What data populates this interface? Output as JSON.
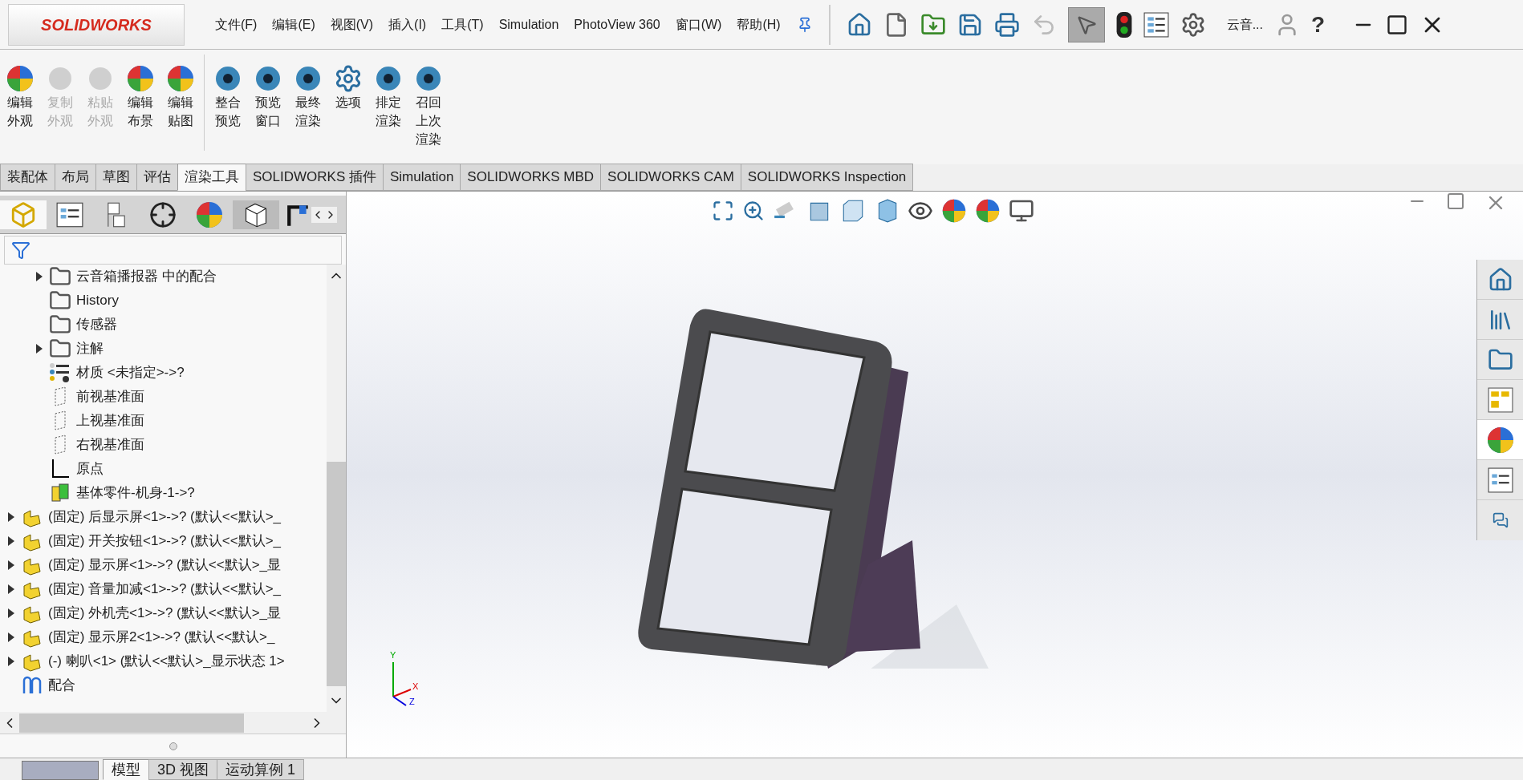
{
  "title_bar": {
    "logo": "SOLIDWORKS",
    "menu": [
      "文件(F)",
      "编辑(E)",
      "视图(V)",
      "插入(I)",
      "工具(T)",
      "Simulation",
      "PhotoView 360",
      "窗口(W)",
      "帮助(H)"
    ],
    "document": "云音...",
    "help": "?"
  },
  "ribbon": {
    "buttons": [
      {
        "lines": [
          "编辑",
          "外观"
        ],
        "disabled": false
      },
      {
        "lines": [
          "复制",
          "外观"
        ],
        "disabled": true
      },
      {
        "lines": [
          "粘贴",
          "外观"
        ],
        "disabled": true
      },
      {
        "lines": [
          "编辑",
          "布景"
        ],
        "disabled": false
      },
      {
        "lines": [
          "编辑",
          "贴图"
        ],
        "disabled": false
      },
      {
        "lines": [
          "整合",
          "预览"
        ],
        "disabled": false
      },
      {
        "lines": [
          "预览",
          "窗口"
        ],
        "disabled": false
      },
      {
        "lines": [
          "最终",
          "渲染"
        ],
        "disabled": false
      },
      {
        "lines": [
          "选项"
        ],
        "disabled": false
      },
      {
        "lines": [
          "排定",
          "渲染"
        ],
        "disabled": false
      },
      {
        "lines": [
          "召回",
          "上次",
          "渲染"
        ],
        "disabled": false
      }
    ]
  },
  "command_tabs": [
    {
      "label": "装配体",
      "selected": false
    },
    {
      "label": "布局",
      "selected": false
    },
    {
      "label": "草图",
      "selected": false
    },
    {
      "label": "评估",
      "selected": false
    },
    {
      "label": "渲染工具",
      "selected": true
    },
    {
      "label": "SOLIDWORKS 插件",
      "selected": false
    },
    {
      "label": "Simulation",
      "selected": false
    },
    {
      "label": "SOLIDWORKS MBD",
      "selected": false
    },
    {
      "label": "SOLIDWORKS CAM",
      "selected": false
    },
    {
      "label": "SOLIDWORKS Inspection",
      "selected": false
    }
  ],
  "tree": [
    {
      "kind": "mates",
      "label": "云音箱播报器 中的配合",
      "expandable": true
    },
    {
      "kind": "history",
      "label": "History",
      "expandable": false
    },
    {
      "kind": "sensors",
      "label": "传感器",
      "expandable": false
    },
    {
      "kind": "annotations",
      "label": "注解",
      "expandable": true
    },
    {
      "kind": "material",
      "label": "材质 <未指定>->?",
      "expandable": false
    },
    {
      "kind": "plane",
      "label": "前视基准面",
      "expandable": false
    },
    {
      "kind": "plane",
      "label": "上视基准面",
      "expandable": false
    },
    {
      "kind": "plane",
      "label": "右视基准面",
      "expandable": false
    },
    {
      "kind": "origin",
      "label": "原点",
      "expandable": false
    },
    {
      "kind": "base",
      "label": "基体零件-机身-1->?",
      "expandable": false
    },
    {
      "kind": "component",
      "label": "(固定) 后显示屏<1>->? (默认<<默认>_",
      "expandable": true
    },
    {
      "kind": "component",
      "label": "(固定) 开关按钮<1>->? (默认<<默认>_",
      "expandable": true
    },
    {
      "kind": "component",
      "label": "(固定) 显示屏<1>->? (默认<<默认>_显",
      "expandable": true
    },
    {
      "kind": "component",
      "label": "(固定) 音量加减<1>->? (默认<<默认>_",
      "expandable": true
    },
    {
      "kind": "component",
      "label": "(固定) 外机壳<1>->? (默认<<默认>_显",
      "expandable": true
    },
    {
      "kind": "component",
      "label": "(固定) 显示屏2<1>->? (默认<<默认>_",
      "expandable": true
    },
    {
      "kind": "component",
      "label": "(-) 喇叭<1> (默认<<默认>_显示状态 1>",
      "expandable": true
    },
    {
      "kind": "mategroup",
      "label": "配合",
      "expandable": false
    }
  ],
  "bottom_tabs": [
    {
      "label": "模型",
      "selected": true
    },
    {
      "label": "3D 视图",
      "selected": false
    },
    {
      "label": "运动算例 1",
      "selected": false
    }
  ],
  "triad": {
    "y": "Y",
    "x": "X",
    "z": "Z"
  }
}
